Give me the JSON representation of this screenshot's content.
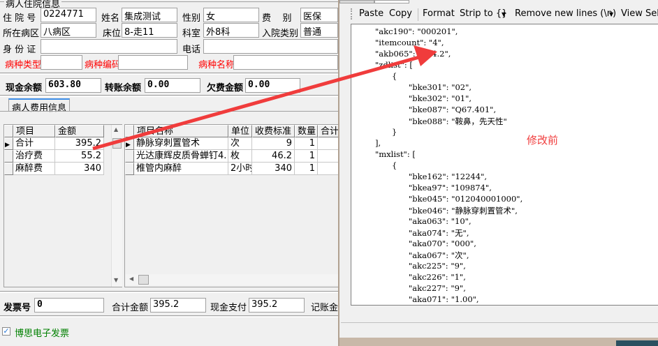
{
  "patient": {
    "group_title": "病人住院信息",
    "labels": {
      "admission_no": "住 院 号",
      "name": "姓名",
      "sex": "性别",
      "fee_type": "费    别",
      "ward": "所在病区",
      "bed": "床位",
      "dept": "科室",
      "admit_type": "入院类别",
      "id_card": "身 份 证",
      "phone": "电话",
      "disease_type": "病种类型",
      "disease_code": "病种编码",
      "disease_name": "病种名称"
    },
    "values": {
      "admission_no": "0224771",
      "name": "集成测试",
      "sex": "女",
      "fee_type": "医保",
      "ward": "八病区",
      "bed": "8-走11",
      "dept": "外8科",
      "admit_type": "普通",
      "id_card": "",
      "phone": "",
      "disease_type": "",
      "disease_code": "",
      "disease_name": ""
    }
  },
  "balance": {
    "cash_label": "现金余额",
    "cash": "603.80",
    "transfer_label": "转账余额",
    "transfer": "0.00",
    "arrears_label": "欠费金额",
    "arrears": "0.00"
  },
  "tab": "病人费用信息",
  "summary_table": {
    "headers": [
      "项目",
      "金额"
    ],
    "rows": [
      [
        "合计",
        "395.2"
      ],
      [
        "治疗费",
        "55.2"
      ],
      [
        "麻醉费",
        "340"
      ]
    ]
  },
  "detail_table": {
    "headers": [
      "项目名称",
      "单位",
      "收费标准",
      "数量",
      "合计"
    ],
    "rows": [
      [
        "静脉穿刺置管术",
        "次",
        "9",
        "1"
      ],
      [
        "光达康辉皮质骨蝉钉4.",
        "枚",
        "46.2",
        "1"
      ],
      [
        "椎管内麻醉",
        "2小时",
        "340",
        "1"
      ]
    ]
  },
  "footer": {
    "invoice_label": "发票号",
    "invoice": "0",
    "total_label": "合计金额",
    "total": "395.2",
    "cash_pay_label": "现金支付",
    "cash_pay": "395.2",
    "account_label": "记账金"
  },
  "einvoice": {
    "label": "博思电子发票",
    "checked": true
  },
  "json_tool": {
    "toolbar": [
      "Paste",
      "Copy",
      "Format",
      "Strip to {}",
      "Remove new lines (\\n)",
      "View Sele"
    ],
    "annotation": "修改前",
    "lines": [
      {
        "i": 1,
        "t": "\"akc190\": \"000201\","
      },
      {
        "i": 1,
        "t": "\"itemcount\": \"4\","
      },
      {
        "i": 1,
        "t": "\"akb065\": \"744.2\","
      },
      {
        "i": 1,
        "t": "\"zdlist\": ["
      },
      {
        "i": 2,
        "t": "{"
      },
      {
        "i": 3,
        "t": "\"bke301\": \"02\","
      },
      {
        "i": 3,
        "t": "\"bke302\": \"01\","
      },
      {
        "i": 3,
        "t": "\"bke087\": \"Q67.401\","
      },
      {
        "i": 3,
        "t": "\"bke088\": \"鞍鼻，先天性\""
      },
      {
        "i": 2,
        "t": "}"
      },
      {
        "i": 1,
        "t": "],"
      },
      {
        "i": 1,
        "t": "\"mxlist\": ["
      },
      {
        "i": 2,
        "t": "{"
      },
      {
        "i": 3,
        "t": "\"bke162\": \"12244\","
      },
      {
        "i": 3,
        "t": "\"bkea97\": \"109874\","
      },
      {
        "i": 3,
        "t": "\"bke045\": \"012040001000\","
      },
      {
        "i": 3,
        "t": "\"bke046\": \"静脉穿刺置管术\","
      },
      {
        "i": 3,
        "t": "\"aka063\": \"10\","
      },
      {
        "i": 3,
        "t": "\"aka074\": \"无\","
      },
      {
        "i": 3,
        "t": "\"aka070\": \"000\","
      },
      {
        "i": 3,
        "t": "\"aka067\": \"次\","
      },
      {
        "i": 3,
        "t": "\"akc225\": \"9\","
      },
      {
        "i": 3,
        "t": "\"akc226\": \"1\","
      },
      {
        "i": 3,
        "t": "\"akc227\": \"9\","
      },
      {
        "i": 3,
        "t": "\"aka071\": \"1.00\","
      }
    ]
  },
  "colors": {
    "arrow": "#f03c3c",
    "required_label": "#ff0000",
    "einvoice_label": "#008000"
  }
}
